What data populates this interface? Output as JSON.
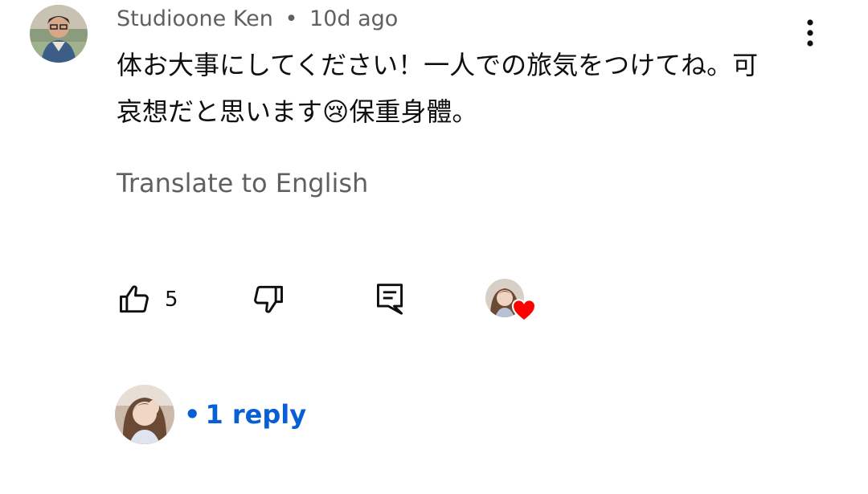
{
  "comment": {
    "author": "Studioone Ken",
    "separator": "•",
    "time_ago": "10d ago",
    "text": "体お大事にしてください！一人での旅気をつけてね。可哀想だと思います😢保重身體。",
    "translate_label": "Translate to English",
    "more_icon": "vertical-dots-icon"
  },
  "actions": {
    "like_count": "5",
    "like_icon": "thumbs-up-icon",
    "dislike_icon": "thumbs-down-icon",
    "reply_icon": "comment-reply-icon",
    "creator_heart_icon": "heart-icon",
    "heart_color": "#ff0000"
  },
  "replies": {
    "bullet": "•",
    "label": "1 reply",
    "link_color": "#065fd4"
  }
}
